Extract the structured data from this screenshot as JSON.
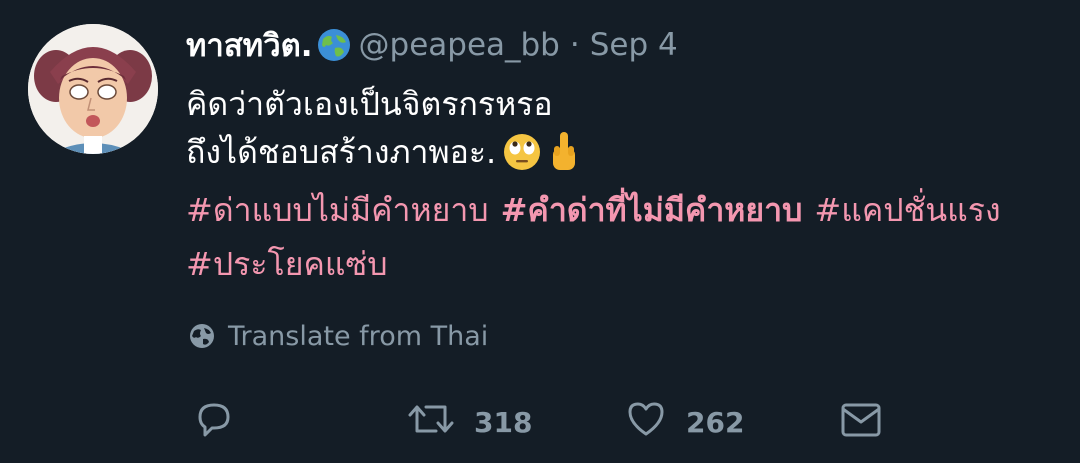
{
  "tweet": {
    "display_name": "ทาสทวิต.",
    "display_name_emoji": "globe-emoji",
    "handle": "@peapea_bb",
    "separator": "·",
    "date": "Sep 4",
    "text_line_1": "คิดว่าตัวเองเป็นจิตรกรหรอ",
    "text_line_2": "ถึงได้ชอบสร้างภาพอะ.",
    "text_line_2_emojis": [
      "face-with-rolling-eyes-emoji",
      "middle-finger-emoji"
    ],
    "hashtags_line_3": [
      {
        "text": "#ด่าแบบไม่มีคำหยาบ",
        "bold": false
      },
      {
        "text": "#คำด่าที่ไม่มีคำหยาบ",
        "bold": true
      },
      {
        "text": "#แคปชั่นแรง",
        "bold": false
      }
    ],
    "hashtags_line_4": [
      {
        "text": "#ประโยคแซ่บ",
        "bold": false
      }
    ],
    "translate_label": "Translate from Thai"
  },
  "actions": {
    "reply_icon": "reply-icon",
    "retweet_icon": "retweet-icon",
    "retweet_count": "318",
    "like_icon": "heart-icon",
    "like_count": "262",
    "dm_icon": "envelope-icon"
  },
  "colors": {
    "background": "#141d26",
    "text": "#ffffff",
    "secondary": "#8899a6",
    "hashtag": "#f497b0"
  }
}
